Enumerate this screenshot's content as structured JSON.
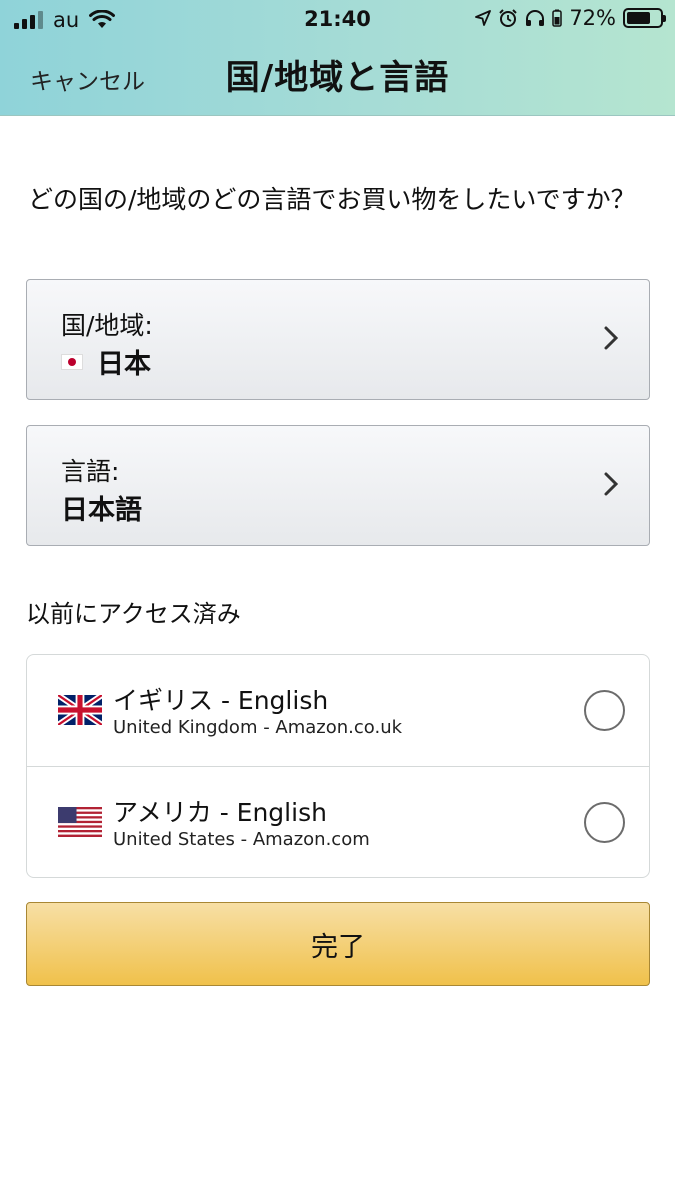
{
  "status_bar": {
    "carrier": "au",
    "time": "21:40",
    "battery": "72%"
  },
  "header": {
    "cancel_label": "キャンセル",
    "title": "国/地域と言語"
  },
  "question": "どの国の/地域のどの言語でお買い物をしたいですか？",
  "country_select": {
    "label": "国/地域:",
    "value": "日本",
    "flag_icon": "japan-flag-icon"
  },
  "language_select": {
    "label": "言語:",
    "value": "日本語"
  },
  "previous": {
    "title": "以前にアクセス済み",
    "items": [
      {
        "title": "イギリス - English",
        "subtitle": "United Kingdom - Amazon.co.uk",
        "flag_icon": "uk-flag-icon"
      },
      {
        "title": "アメリカ - English",
        "subtitle": "United States - Amazon.com",
        "flag_icon": "us-flag-icon"
      }
    ]
  },
  "done_label": "完了",
  "colors": {
    "header_gradient_start": "#8fd3d9",
    "header_gradient_end": "#b5e5d0",
    "button_top": "#f7dfa5",
    "button_bottom": "#f0c14b"
  }
}
